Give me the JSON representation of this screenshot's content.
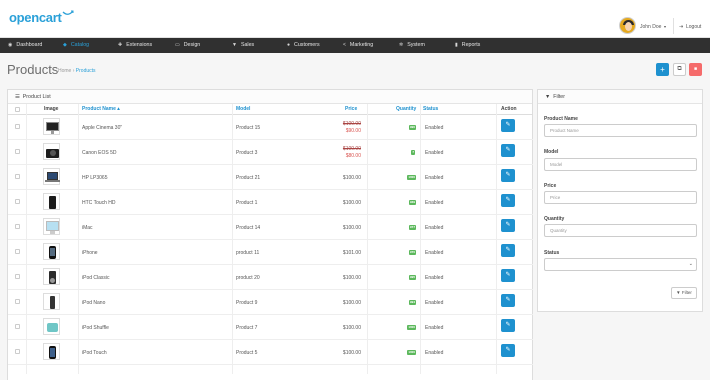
{
  "brand": {
    "name": "opencart",
    "accent": "#2aa0d8"
  },
  "user": {
    "name": "John Doe",
    "logout_label": "Logout",
    "avatar_icon": "user-avatar"
  },
  "nav": [
    {
      "label": "Dashboard",
      "icon": "dashboard-icon",
      "glyph": "◉"
    },
    {
      "label": "Catalog",
      "icon": "tag-icon",
      "glyph": "◆",
      "active": true
    },
    {
      "label": "Extensions",
      "icon": "puzzle-icon",
      "glyph": "✚"
    },
    {
      "label": "Design",
      "icon": "monitor-icon",
      "glyph": "▭"
    },
    {
      "label": "Sales",
      "icon": "cart-icon",
      "glyph": "▼"
    },
    {
      "label": "Customers",
      "icon": "user-icon",
      "glyph": "●"
    },
    {
      "label": "Marketing",
      "icon": "share-icon",
      "glyph": "<"
    },
    {
      "label": "System",
      "icon": "gear-icon",
      "glyph": "✲"
    },
    {
      "label": "Reports",
      "icon": "bar-chart-icon",
      "glyph": "▮"
    }
  ],
  "page": {
    "title": "Products",
    "breadcrumb": [
      "Home",
      "Products"
    ],
    "breadcrumb_sep": "›",
    "action_add_glyph": "+",
    "action_copy_glyph": "⧉",
    "action_delete_glyph": "■",
    "colors": {
      "add": "#1e91cf",
      "delete": "#f56b6b"
    }
  },
  "list": {
    "panel_title": "Product List",
    "columns": {
      "image": "Image",
      "name": "Product Name ▴",
      "model": "Model",
      "price": "Price",
      "quantity": "Quantity",
      "status": "Status",
      "action": "Action"
    },
    "edit_glyph": "✎",
    "rows": [
      {
        "name": "Apple Cinema 30\"",
        "model": "Product 15",
        "price_old": "$100.00",
        "price_new": "$90.00",
        "qty": "990",
        "status": "Enabled",
        "thumb": "monitor"
      },
      {
        "name": "Canon EOS 5D",
        "model": "Product 3",
        "price_old": "$100.00",
        "price_new": "$80.00",
        "qty": "7",
        "status": "Enabled",
        "thumb": "camera"
      },
      {
        "name": "HP LP3065",
        "model": "Product 21",
        "price": "$100.00",
        "qty": "1000",
        "status": "Enabled",
        "thumb": "laptop"
      },
      {
        "name": "HTC Touch HD",
        "model": "Product 1",
        "price": "$100.00",
        "qty": "939",
        "status": "Enabled",
        "thumb": "phone"
      },
      {
        "name": "iMac",
        "model": "Product 14",
        "price": "$100.00",
        "qty": "977",
        "status": "Enabled",
        "thumb": "imac"
      },
      {
        "name": "iPhone",
        "model": "product 11",
        "price": "$101.00",
        "qty": "970",
        "status": "Enabled",
        "thumb": "iphone"
      },
      {
        "name": "iPod Classic",
        "model": "product 20",
        "price": "$100.00",
        "qty": "995",
        "status": "Enabled",
        "thumb": "ipod"
      },
      {
        "name": "iPod Nano",
        "model": "Product 9",
        "price": "$100.00",
        "qty": "994",
        "status": "Enabled",
        "thumb": "nano"
      },
      {
        "name": "iPod Shuffle",
        "model": "Product 7",
        "price": "$100.00",
        "qty": "1000",
        "status": "Enabled",
        "thumb": "shuffle"
      },
      {
        "name": "iPod Touch",
        "model": "Product 5",
        "price": "$100.00",
        "qty": "1000",
        "status": "Enabled",
        "thumb": "touch"
      }
    ]
  },
  "filter": {
    "panel_title": "Filter",
    "name_label": "Product Name",
    "name_placeholder": "Product Name",
    "model_label": "Model",
    "model_placeholder": "Model",
    "price_label": "Price",
    "price_placeholder": "Price",
    "quantity_label": "Quantity",
    "quantity_placeholder": "Quantity",
    "status_label": "Status",
    "status_value": "",
    "button_label": "Filter"
  }
}
